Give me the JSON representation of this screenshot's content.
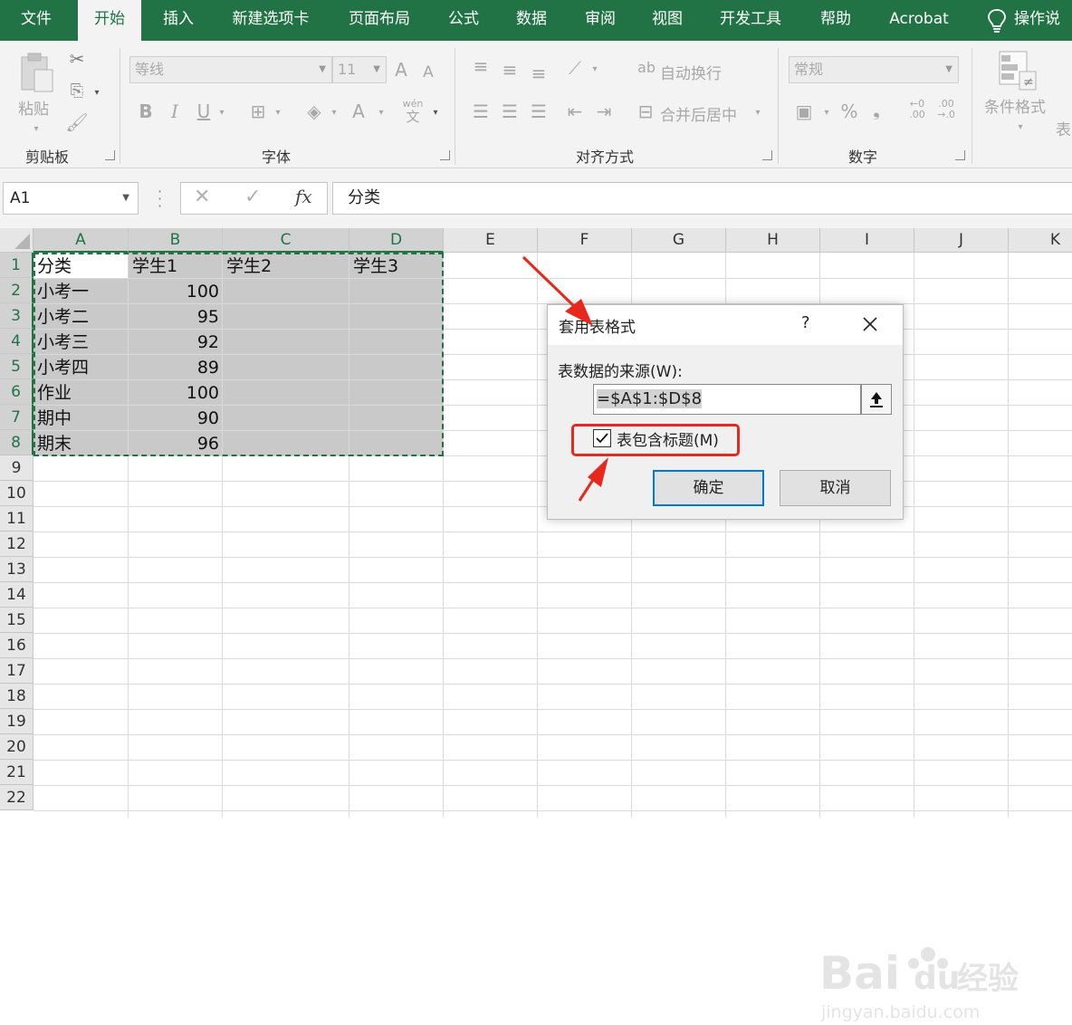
{
  "ribbon_tabs": [
    "文件",
    "开始",
    "插入",
    "新建选项卡",
    "页面布局",
    "公式",
    "数据",
    "审阅",
    "视图",
    "开发工具",
    "帮助",
    "Acrobat"
  ],
  "tell_me": "操作说",
  "clipboard": {
    "paste": "粘贴",
    "group": "剪贴板"
  },
  "font": {
    "name": "等线",
    "size": "11",
    "bold": "B",
    "italic": "I",
    "underline": "U",
    "group": "字体",
    "grow": "A",
    "shrink": "A",
    "font_color": "A",
    "phonetic_top": "wén",
    "phonetic_bottom": "文"
  },
  "alignment": {
    "wrap": "自动换行",
    "merge": "合并后居中",
    "group": "对齐方式"
  },
  "number": {
    "format": "常规",
    "percent": "%",
    "comma": "❟",
    "inc": "←0\n.00",
    "group": "数字"
  },
  "styles": {
    "conditional": "条件格式",
    "table_partial": "表"
  },
  "formula_bar": {
    "name_box": "A1",
    "fx": "fx",
    "content": "分类"
  },
  "columns": [
    "A",
    "B",
    "C",
    "D",
    "E",
    "F",
    "G",
    "H",
    "I",
    "J",
    "K"
  ],
  "rows": [
    "1",
    "2",
    "3",
    "4",
    "5",
    "6",
    "7",
    "8",
    "9",
    "10",
    "11",
    "12",
    "13",
    "14",
    "15",
    "16",
    "17",
    "18",
    "19",
    "20",
    "21",
    "22"
  ],
  "sheet": {
    "headers": [
      "分类",
      "学生1",
      "学生2",
      "学生3"
    ],
    "data": [
      {
        "cat": "小考一",
        "val": "100"
      },
      {
        "cat": "小考二",
        "val": "95"
      },
      {
        "cat": "小考三",
        "val": "92"
      },
      {
        "cat": "小考四",
        "val": "89"
      },
      {
        "cat": "作业",
        "val": "100"
      },
      {
        "cat": "期中",
        "val": "90"
      },
      {
        "cat": "期末",
        "val": "96"
      }
    ]
  },
  "dialog": {
    "title": "套用表格式",
    "help": "?",
    "source_label": "表数据的来源(W):",
    "source_value": "=$A$1:$D$8",
    "checkbox_label": "表包含标题(M)",
    "checkbox_checked": true,
    "ok": "确定",
    "cancel": "取消"
  },
  "watermark": {
    "brand": "Bai",
    "brand2": "du",
    "cn": "经验",
    "url": "jingyan.baidu.com"
  },
  "colors": {
    "excel_green": "#217346",
    "annotation_red": "#e8281c",
    "focus_blue": "#0078d7"
  }
}
